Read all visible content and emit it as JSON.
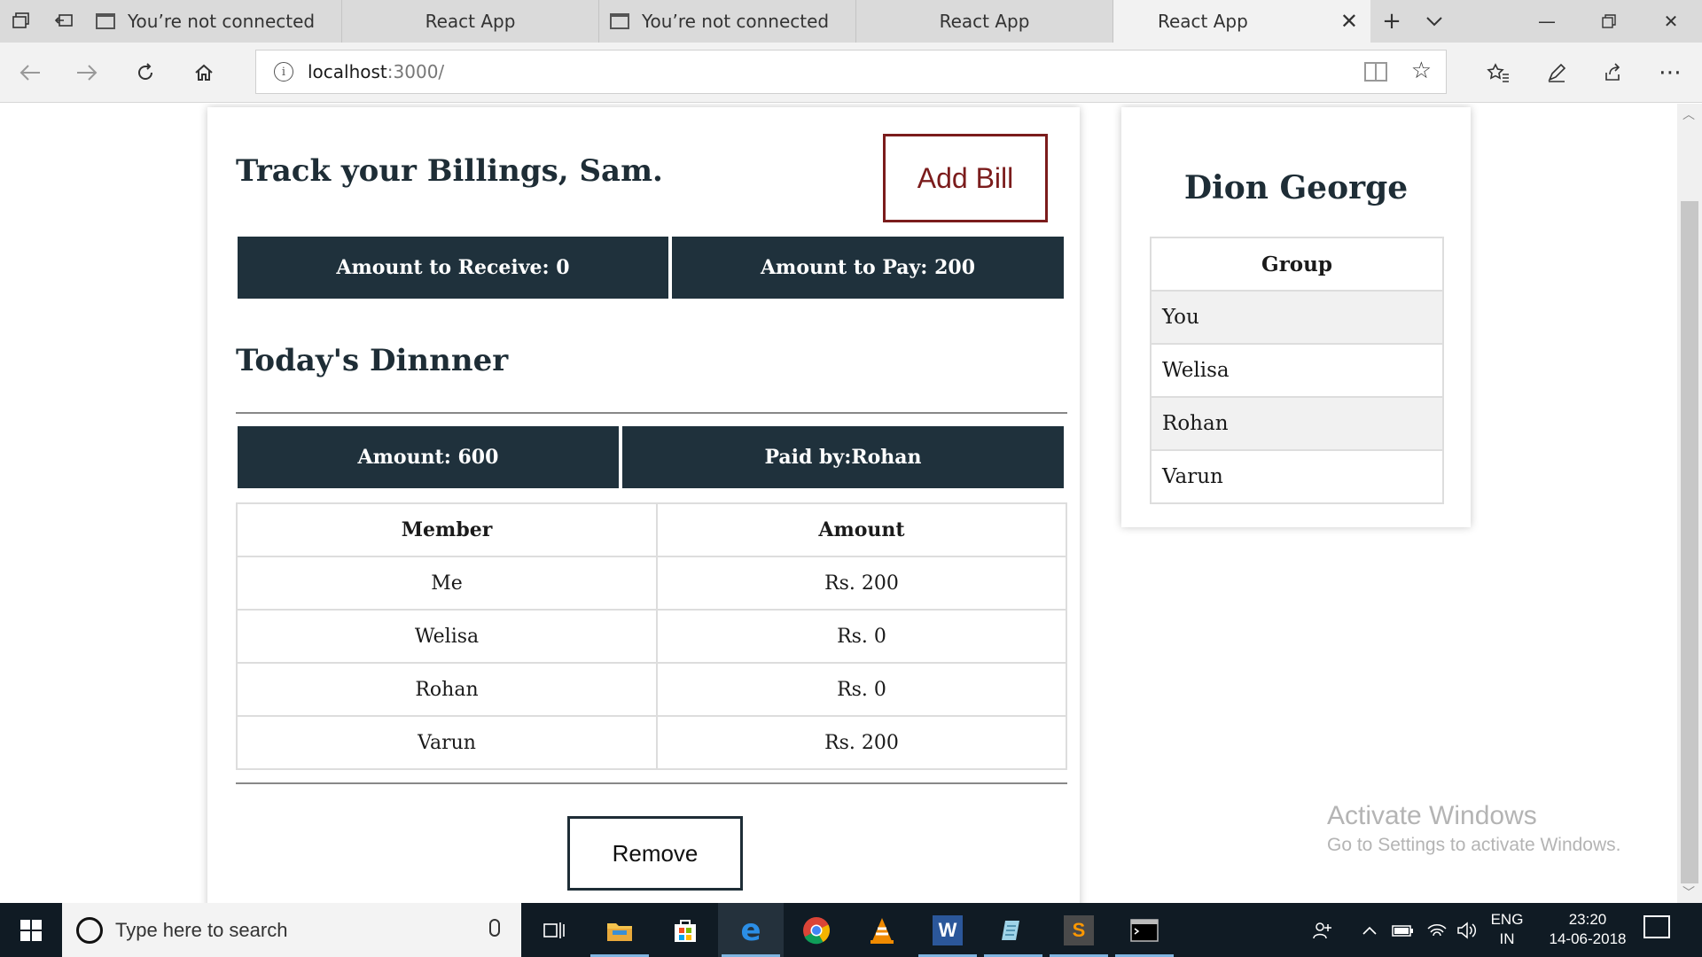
{
  "browser": {
    "tabs": [
      {
        "label": "You’re not connected",
        "active": false
      },
      {
        "label": "React App",
        "active": false
      },
      {
        "label": "You’re not connected",
        "active": false
      },
      {
        "label": "React App",
        "active": false
      },
      {
        "label": "React App",
        "active": true
      }
    ],
    "url_host": "localhost",
    "url_rest": ":3000/"
  },
  "main": {
    "title": "Track your Billings, Sam.",
    "add_bill_label": "Add Bill",
    "summary": {
      "receive": "Amount to Receive: 0",
      "pay": "Amount to Pay: 200"
    },
    "bill": {
      "title": "Today's Dinnner",
      "amount": "Amount: 600",
      "paid_by": "Paid by:Rohan",
      "columns": [
        "Member",
        "Amount"
      ],
      "rows": [
        {
          "member": "Me",
          "amount": "Rs. 200"
        },
        {
          "member": "Welisa",
          "amount": "Rs. 0"
        },
        {
          "member": "Rohan",
          "amount": "Rs. 0"
        },
        {
          "member": "Varun",
          "amount": "Rs. 200"
        }
      ],
      "remove_label": "Remove"
    }
  },
  "sidebar": {
    "user_name": "Dion George",
    "group_header": "Group",
    "members": [
      "You",
      "Welisa",
      "Rohan",
      "Varun"
    ]
  },
  "watermark": {
    "line1": "Activate Windows",
    "line2": "Go to Settings to activate Windows."
  },
  "taskbar": {
    "search_placeholder": "Type here to search",
    "lang_top": "ENG",
    "lang_bottom": "IN",
    "time": "23:20",
    "date": "14-06-2018"
  },
  "colors": {
    "dark_header": "#1f313c",
    "add_bill_accent": "#7b1c1c",
    "taskbar": "#101b24"
  }
}
